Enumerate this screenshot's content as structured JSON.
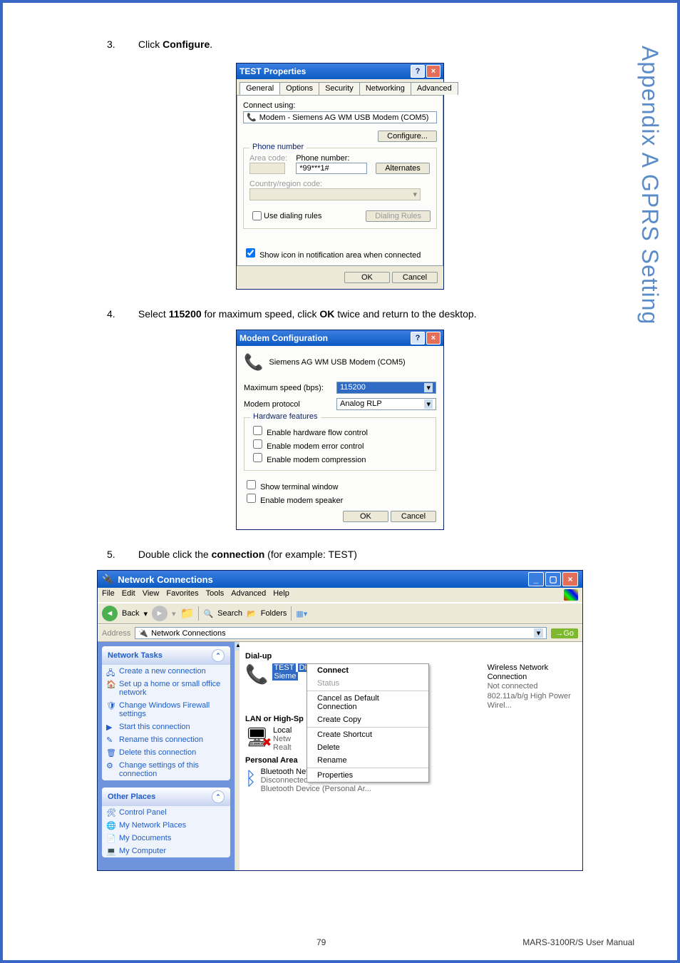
{
  "sidetext": "Appendix A  GPRS Setting",
  "steps": {
    "s3": {
      "num": "3.",
      "pre": "Click ",
      "bold": "Configure",
      "post": "."
    },
    "s4": {
      "num": "4.",
      "pre": "Select ",
      "bold1": "115200",
      "mid": " for maximum speed, click ",
      "bold2": "OK",
      "post": " twice and return to the desktop."
    },
    "s5": {
      "num": "5.",
      "pre": "Double click the ",
      "bold": "connection",
      "post": " (for example: TEST)"
    }
  },
  "dlg1": {
    "title": "TEST Properties",
    "tabs": [
      "General",
      "Options",
      "Security",
      "Networking",
      "Advanced"
    ],
    "connect_using": "Connect using:",
    "modem": "Modem - Siemens AG WM USB Modem (COM5)",
    "configure": "Configure...",
    "phone_number_hdr": "Phone number",
    "area_code": "Area code:",
    "phone_number_lbl": "Phone number:",
    "phone_value": "*99***1#",
    "alternates": "Alternates",
    "country": "Country/region code:",
    "use_dialing": "Use dialing rules",
    "dialing_rules": "Dialing Rules",
    "show_icon": "Show icon in notification area when connected",
    "ok": "OK",
    "cancel": "Cancel"
  },
  "dlg2": {
    "title": "Modem Configuration",
    "modem": "Siemens AG WM USB Modem (COM5)",
    "max_speed": "Maximum speed (bps):",
    "speed": "115200",
    "protocol_lbl": "Modem protocol",
    "protocol": "Analog RLP",
    "hw_hdr": "Hardware features",
    "hw_flow": "Enable hardware flow control",
    "err_ctl": "Enable modem error control",
    "compress": "Enable modem compression",
    "terminal": "Show terminal window",
    "speaker": "Enable modem speaker",
    "ok": "OK",
    "cancel": "Cancel"
  },
  "nc": {
    "title": "Network Connections",
    "menu": [
      "File",
      "Edit",
      "View",
      "Favorites",
      "Tools",
      "Advanced",
      "Help"
    ],
    "back": "Back",
    "search": "Search",
    "folders": "Folders",
    "address_lbl": "Address",
    "address_val": "Network Connections",
    "go": "Go",
    "tasks_hdr": "Network Tasks",
    "tasks": [
      "Create a new connection",
      "Set up a home or small office network",
      "Change Windows Firewall settings",
      "Start this connection",
      "Rename this connection",
      "Delete this connection",
      "Change settings of this connection"
    ],
    "other_hdr": "Other Places",
    "others": [
      "Control Panel",
      "My Network Places",
      "My Documents",
      "My Computer"
    ],
    "group_dial": "Dial-up",
    "conn_test": {
      "name": "TEST",
      "state": "Disco",
      "dev": "Sieme"
    },
    "group_lan": "LAN or High-Sp",
    "lan_items": [
      "Local",
      "Netw",
      "Realt"
    ],
    "wireless": {
      "name": "Wireless Network Connection",
      "state": "Not connected",
      "dev": "802.11a/b/g High Power Wirel..."
    },
    "group_pan": "Personal Area",
    "pan": {
      "name": "Bluetooth Network Connection",
      "state": "Disconnected",
      "dev": "Bluetooth Device (Personal Ar..."
    },
    "ctx": {
      "connect": "Connect",
      "status": "Status",
      "cancel_default": "Cancel as Default Connection",
      "copy": "Create Copy",
      "shortcut": "Create Shortcut",
      "delete": "Delete",
      "rename": "Rename",
      "props": "Properties"
    }
  },
  "footer": {
    "page": "79",
    "manual": "MARS-3100R/S User Manual"
  }
}
